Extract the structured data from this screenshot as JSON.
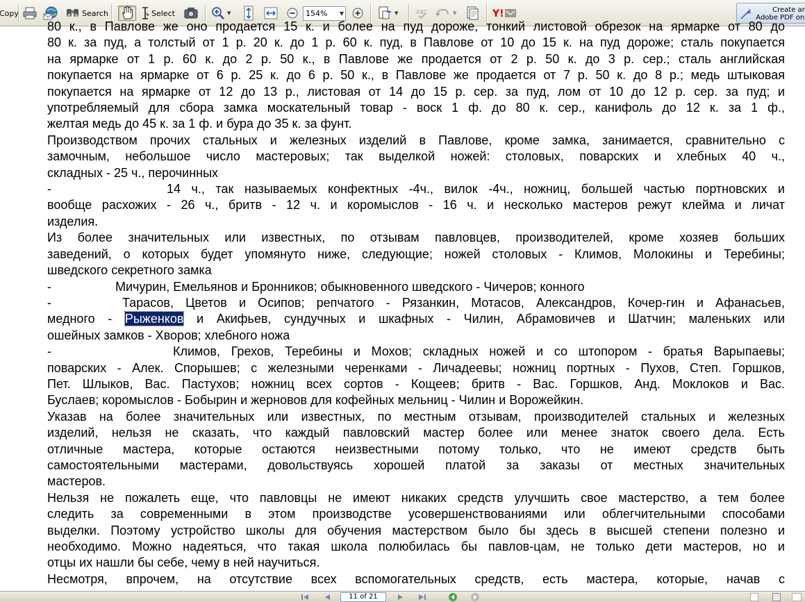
{
  "app": {
    "toolbar": {
      "copy_label": "Copy",
      "search_label": "Search",
      "select_label": "Select",
      "zoom_value": "154%",
      "create_pdf_line1": "Create an",
      "create_pdf_line2": "Adobe PDF onl",
      "icons": [
        "copy-icon",
        "print-icon",
        "email-icon",
        "search-icon",
        "hand-tool-icon",
        "select-text-icon",
        "snapshot-icon",
        "zoom-in-tool-icon",
        "fit-height-icon",
        "fit-width-icon",
        "zoom-out-icon",
        "zoom-in-icon",
        "pages-icon",
        "spellcheck-icon",
        "undo-icon",
        "organizer-icon",
        "yahoo-icon",
        "create-pdf-icon"
      ]
    },
    "statusbar": {
      "page_indicator": "11 of 21",
      "icons": [
        "first-page-icon",
        "previous-page-icon",
        "next-page-icon",
        "last-page-icon",
        "back-view-icon",
        "forward-view-icon"
      ]
    },
    "colors": {
      "selection": "#0a246a",
      "toolbar_bg": "#ece9d8"
    }
  },
  "document": {
    "lines": [
      {
        "j": true,
        "cls": "first-cut",
        "parts": [
          {
            "t": "80 к., в Павлове же оно продается 15 к. и более на пуд дороже, тонкий листовой обрезок на ярмарке от 80 до"
          }
        ]
      },
      {
        "j": true,
        "parts": [
          {
            "t": "80 к. за пуд, а толстый от 1 р. 20 к. до 1 р. 60 к. пуд, в Павлове от 10 до 15 к. на пуд дороже; сталь покупается"
          }
        ]
      },
      {
        "j": true,
        "parts": [
          {
            "t": "на ярмарке от 1 р. 60 к. до 2 р. 50 к., в Павлове же продается от 2 р. 50 к. до 3 р. сер.; сталь английская"
          }
        ]
      },
      {
        "j": true,
        "parts": [
          {
            "t": "покупается на ярмарке от 6 р. 25 к. до 6 р. 50 к., в Павлове же продается от 7 р. 50 к. до 8 р.; медь штыковая"
          }
        ]
      },
      {
        "j": true,
        "parts": [
          {
            "t": "покупается на ярмарке от 12 до 13 р., листовая от 14 до 15 р. сер. за пуд, лом от 10 до 12 р. сер. за пуд; и"
          }
        ]
      },
      {
        "j": true,
        "parts": [
          {
            "t": "употребляемый для сбора замка москательный товар - воск 1 ф. до 80 к. сер., канифоль до 12 к. за 1 ф.,"
          }
        ]
      },
      {
        "j": false,
        "parts": [
          {
            "t": "желтая медь до 45 к. за 1 ф. и бура до 35 к. за фунт."
          }
        ]
      },
      {
        "j": true,
        "parts": [
          {
            "t": "Производством прочих стальных и железных изделий в Павлове, кроме замка, занимается, сравнительно с"
          }
        ]
      },
      {
        "j": true,
        "parts": [
          {
            "t": "замочным, небольшое число мастеровых; так выделкой ножей: столовых, поварских и хлебных 40 ч.,"
          }
        ]
      },
      {
        "j": false,
        "parts": [
          {
            "t": "складных - 25 ч., перочинных"
          }
        ]
      },
      {
        "j": true,
        "parts": [
          {
            "t": "-",
            "gap": 166
          },
          {
            "t": "14 ч., так называемых конфектных -4ч., вилок -4ч., ножниц, большей частью портновских и"
          }
        ]
      },
      {
        "j": true,
        "parts": [
          {
            "t": "вообще расхожих - 26 ч., бритв - 12 ч. и коромыслов - 16 ч. и несколько мастеров режут клейма и личат"
          }
        ]
      },
      {
        "j": false,
        "parts": [
          {
            "t": "изделия."
          }
        ]
      },
      {
        "j": true,
        "parts": [
          {
            "t": "Из более значительных или известных, по отзывам павловцев, производителей, кроме хозяев больших"
          }
        ]
      },
      {
        "j": true,
        "parts": [
          {
            "t": "заведений, о которых будет упомянуто ниже, следующие; ножей столовых - Климов, Молокины и Теребины;"
          }
        ]
      },
      {
        "j": false,
        "parts": [
          {
            "t": "шведского секретного замка"
          }
        ]
      },
      {
        "j": false,
        "parts": [
          {
            "t": "-",
            "gap": 92
          },
          {
            "t": "Мичурин, Емельянов и Бронников; обыкновенного шведского - Чичеров; конного"
          }
        ]
      },
      {
        "j": true,
        "parts": [
          {
            "t": "-",
            "gap": 102
          },
          {
            "t": "Тарасов, Цветов и Осипов; репчатого - Рязанкин, Мотасов, Александров, Кочер-гин и Афанасьев,"
          }
        ]
      },
      {
        "j": true,
        "parts": [
          {
            "t": "медного - "
          },
          {
            "t": "Рыженков",
            "sel": true
          },
          {
            "t": " и Акифьев, сундучных и шкафных - Чилин, Абрамовичев и Шатчин; маленьких или"
          }
        ]
      },
      {
        "j": false,
        "parts": [
          {
            "t": "ошейных замков - Хворов; хлебного ножа"
          }
        ]
      },
      {
        "j": true,
        "parts": [
          {
            "t": "-",
            "gap": 175
          },
          {
            "t": "Климов, Грехов, Теребины и Мохов; складных ножей и со штопором - братья Варыпаевы;"
          }
        ]
      },
      {
        "j": true,
        "parts": [
          {
            "t": "поварских - Алек. Спорышев; с железными черенками - Личадеевы; ножниц портных - Пухов, Степ. Горшков,"
          }
        ]
      },
      {
        "j": true,
        "parts": [
          {
            "t": "Пет. Шлыков, Вас. Пастухов; ножниц всех сортов - Кощеев; бритв - Вас. Горшков, Анд. Моклоков и Вас."
          }
        ]
      },
      {
        "j": false,
        "parts": [
          {
            "t": "Буслаев; коромыслов - Бобырин и жерновов для кофейных мельниц - Чилин и Ворожейкин."
          }
        ]
      },
      {
        "j": true,
        "parts": [
          {
            "t": "Указав на более значительных или известных, по местным отзывам, производителей стальных и железных"
          }
        ]
      },
      {
        "j": true,
        "parts": [
          {
            "t": "изделий, нельзя не сказать, что каждый павловский мастер более или менее знаток своего дела. Есть"
          }
        ]
      },
      {
        "j": true,
        "parts": [
          {
            "t": "отличные мастера, которые остаются неизвестными потому только, что не имеют средств быть"
          }
        ]
      },
      {
        "j": true,
        "parts": [
          {
            "t": "самостоятельными мастерами, довольствуясь хорошей платой за заказы от местных значительных"
          }
        ]
      },
      {
        "j": false,
        "parts": [
          {
            "t": "мастеров."
          }
        ]
      },
      {
        "j": true,
        "parts": [
          {
            "t": "Нельзя не пожалеть еще, что павловцы не имеют никаких средств улучшить свое мастерство, а тем более"
          }
        ]
      },
      {
        "j": true,
        "parts": [
          {
            "t": "следить за современными в этом производстве усовершенствованиями или облегчительными способами"
          }
        ]
      },
      {
        "j": true,
        "parts": [
          {
            "t": "выделки. Поэтому устройство школы для обучения мастерством было бы здесь в высшей степени полезно и"
          }
        ]
      },
      {
        "j": true,
        "parts": [
          {
            "t": "необходимо. Можно надеяться, что такая школа полюбилась бы павлов-цам, не только дети мастеров, но и"
          }
        ]
      },
      {
        "j": false,
        "parts": [
          {
            "t": "отцы их нашли бы себе, чему в ней научиться."
          }
        ]
      },
      {
        "j": true,
        "parts": [
          {
            "t": "Несмотря, впрочем, на отсутствие всех вспомогательных средств, есть мастера, которые, начав с"
          }
        ]
      }
    ]
  }
}
